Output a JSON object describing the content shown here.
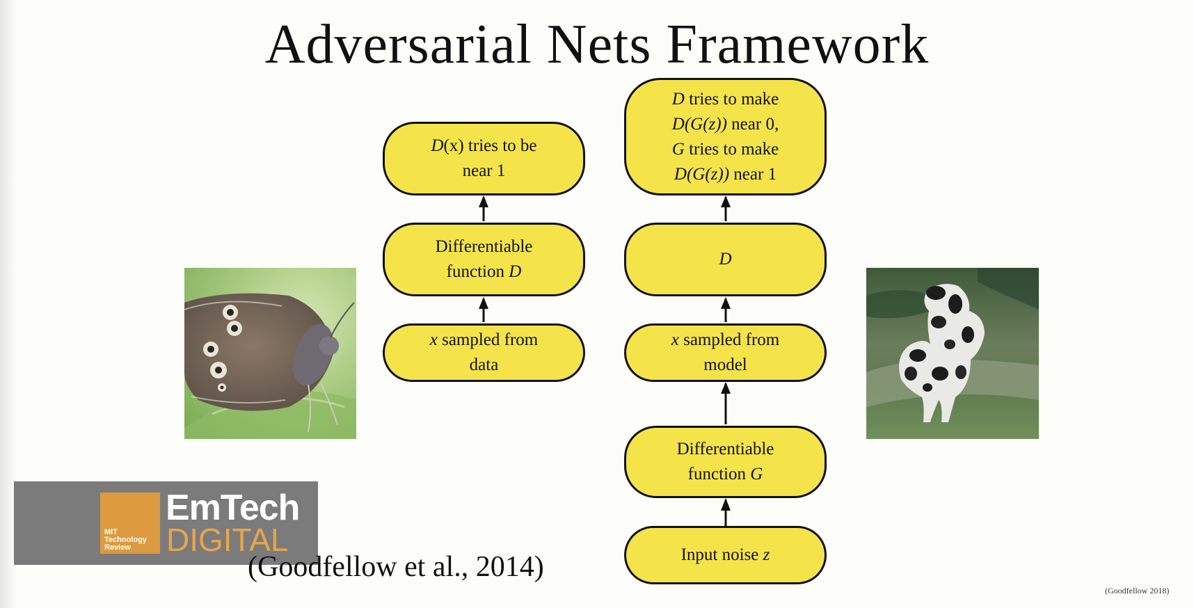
{
  "slide": {
    "title": "Adversarial Nets Framework",
    "citation": "(Goodfellow et al., 2014)",
    "footer_citation": "(Goodfellow 2018)"
  },
  "diagram": {
    "real_path": {
      "top_goal": {
        "line1_var": "D",
        "line1_rest": "(x) tries to be",
        "line2": "near 1"
      },
      "discriminator": {
        "line1": "Differentiable",
        "line2_text": "function ",
        "line2_var": "D"
      },
      "data_sample": {
        "line1_var": "x",
        "line1_rest": " sampled from",
        "line2": "data"
      }
    },
    "fake_path": {
      "top_goal": {
        "line1_var": "D",
        "line1_rest": " tries to make",
        "line2_var": "D(G(z))",
        "line2_rest": " near 0,",
        "line3_var": "G",
        "line3_rest": " tries to make",
        "line4_var": "D(G(z))",
        "line4_rest": " near 1"
      },
      "discriminator": {
        "label": "D"
      },
      "model_sample": {
        "line1_var": "x",
        "line1_rest": " sampled from",
        "line2": "model"
      },
      "generator": {
        "line1": "Differentiable",
        "line2_text": "function ",
        "line2_var": "G"
      },
      "noise": {
        "text": "Input noise ",
        "var": "z"
      }
    }
  },
  "logo": {
    "mit_line1": "MIT",
    "mit_line2": "Technology",
    "mit_line3": "Review",
    "brand_line1": "EmTech",
    "brand_line2": "DIGITAL"
  },
  "colors": {
    "node_fill": "#f5e34a",
    "node_stroke": "#111111",
    "logo_panel": "#7b7b7b",
    "logo_accent": "#dd9a3e"
  }
}
